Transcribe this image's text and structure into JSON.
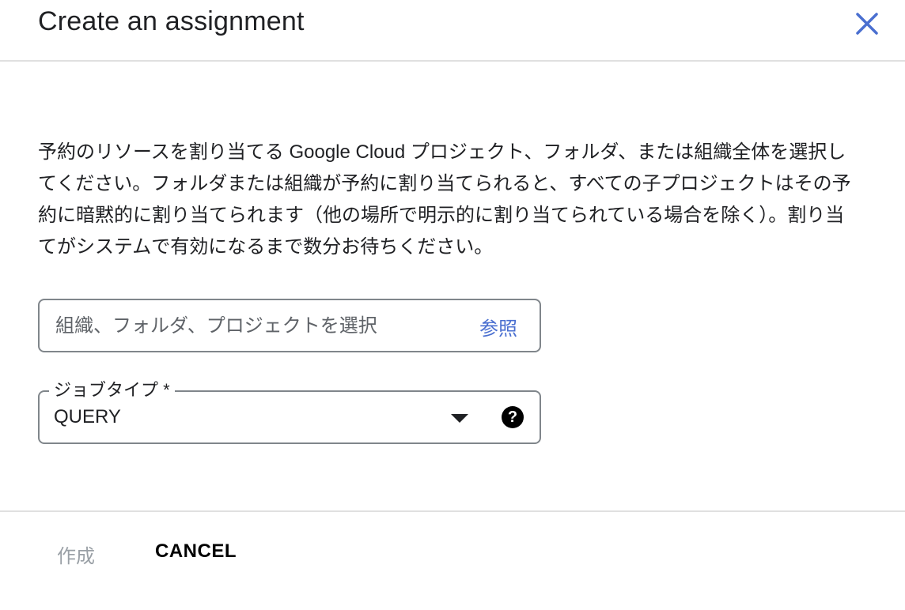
{
  "dialog": {
    "title": "Create an assignment",
    "close_icon": "close-icon"
  },
  "description": "予約のリソースを割り当てる Google Cloud プロジェクト、フォルダ、または組織全体を選択してください。フォルダまたは組織が予約に割り当てられると、すべての子プロジェクトはその予約に暗黙的に割り当てられます（他の場所で明示的に割り当てられている場合を除く）。割り当てがシステムで有効になるまで数分お待ちください。",
  "org_field": {
    "placeholder": "組織、フォルダ、プロジェクトを選択",
    "value": "",
    "browse_label": "参照"
  },
  "job_type": {
    "label": "ジョブタイプ *",
    "selected": "QUERY",
    "dropdown_icon": "arrow-drop-down-icon",
    "help_icon": "help-icon",
    "help_glyph": "?"
  },
  "footer": {
    "create_label": "作成",
    "cancel_label": "CANCEL"
  },
  "colors": {
    "accent": "#4a6fd0",
    "disabled": "#9aa0a6",
    "border": "#80868b",
    "divider": "#e0e0e0"
  }
}
